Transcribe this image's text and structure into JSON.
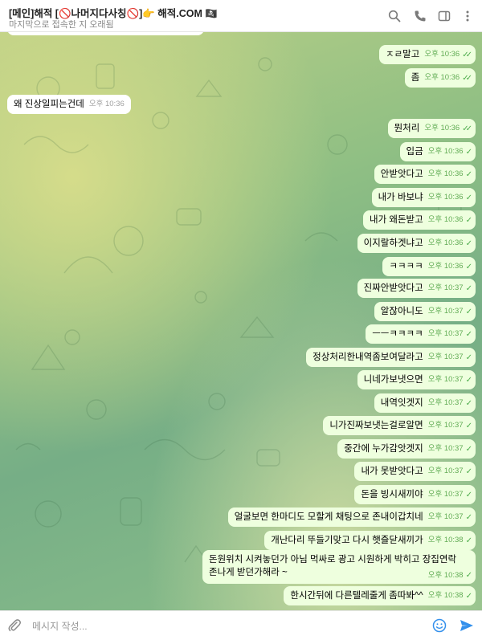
{
  "header": {
    "title": "[메인]해적 [🚫나머지다사칭🚫]👉 해적.COM 🏴‍☠️",
    "status": "마지막으로 접속한 지 오래됨",
    "icons": [
      "search-icon",
      "phone-icon",
      "sidebar-toggle-icon",
      "more-vertical-icon"
    ]
  },
  "messages": [
    {
      "text": "ㅈㄹ말고",
      "time": "오후 10:36",
      "dir": "out",
      "read": true
    },
    {
      "text": "좀",
      "time": "오후 10:36",
      "dir": "out",
      "read": true
    },
    {
      "text": "왜 진상일피는건데",
      "time": "오후 10:36",
      "dir": "in"
    },
    {
      "text": "뭔처리",
      "time": "오후 10:36",
      "dir": "out",
      "read": true
    },
    {
      "text": "입금",
      "time": "오후 10:36",
      "dir": "out",
      "read": false
    },
    {
      "text": "안받앗다고",
      "time": "오후 10:36",
      "dir": "out",
      "read": false
    },
    {
      "text": "내가 바보냐",
      "time": "오후 10:36",
      "dir": "out",
      "read": false
    },
    {
      "text": "내가 왜돈받고",
      "time": "오후 10:36",
      "dir": "out",
      "read": false
    },
    {
      "text": "이지랄하겟냐고",
      "time": "오후 10:36",
      "dir": "out",
      "read": false
    },
    {
      "text": "ㅋㅋㅋㅋ",
      "time": "오후 10:36",
      "dir": "out",
      "read": false
    },
    {
      "text": "진짜안받앗다고",
      "time": "오후 10:37",
      "dir": "out",
      "read": false
    },
    {
      "text": "알잖아니도",
      "time": "오후 10:37",
      "dir": "out",
      "read": false
    },
    {
      "text": "ㅡㅡㅋㅋㅋㅋ",
      "time": "오후 10:37",
      "dir": "out",
      "read": false
    },
    {
      "text": "정상처리한내역좀보여달라고",
      "time": "오후 10:37",
      "dir": "out",
      "read": false
    },
    {
      "text": "니네가보냇으면",
      "time": "오후 10:37",
      "dir": "out",
      "read": false
    },
    {
      "text": "내역잇겟지",
      "time": "오후 10:37",
      "dir": "out",
      "read": false
    },
    {
      "text": "니가진짜보냇는걸로알면",
      "time": "오후 10:37",
      "dir": "out",
      "read": false
    },
    {
      "text": "중간에 누가감앗겟지",
      "time": "오후 10:37",
      "dir": "out",
      "read": false
    },
    {
      "text": "내가 못받앗다고",
      "time": "오후 10:37",
      "dir": "out",
      "read": false
    },
    {
      "text": "돈을 빙시새끼야",
      "time": "오후 10:37",
      "dir": "out",
      "read": false
    },
    {
      "text": "얼굴보면 한마디도 모할게 채팅으로 존내이갑치네",
      "time": "오후 10:37",
      "dir": "out",
      "read": false
    },
    {
      "text": "개난다리 뚜들기맞고 다시 햇즐닫새끼가",
      "time": "오후 10:38",
      "dir": "out",
      "read": false
    },
    {
      "text": "돈원위치 시켜놓던가 아님 먹싸로 광고 시원하게 박히고 장집연락\n존나게 받던가해라 ~",
      "time": "오후 10:38",
      "dir": "out",
      "read": false
    },
    {
      "text": "한시간뒤에 다른텔레줄게 좀따봐^^",
      "time": "오후 10:38",
      "dir": "out",
      "read": false
    }
  ],
  "composer": {
    "placeholder": "메시지 작성...",
    "icons": [
      "attach-icon",
      "emoji-icon",
      "send-icon"
    ]
  },
  "colors": {
    "outgoing_bubble": "#eeffde",
    "incoming_bubble": "#ffffff",
    "accent": "#3390ec",
    "time_outgoing": "#62ac55"
  }
}
